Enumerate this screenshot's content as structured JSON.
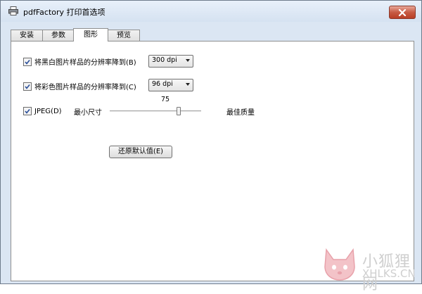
{
  "window": {
    "title": "pdfFactory 打印首选项",
    "icon": "printer-icon",
    "close_icon": "close-icon"
  },
  "tabs": [
    {
      "label": "安装",
      "active": false
    },
    {
      "label": "参数",
      "active": false
    },
    {
      "label": "图形",
      "active": true
    },
    {
      "label": "预览",
      "active": false
    }
  ],
  "graphics": {
    "bw_resolution": {
      "label": "将黑白图片样品的分辨率降到(B)",
      "checked": true,
      "value": "300 dpi"
    },
    "color_resolution": {
      "label": "将彩色图片样品的分辨率降到(C)",
      "checked": true,
      "value": "96 dpi"
    },
    "jpeg": {
      "label": "JPEG(D)",
      "checked": true,
      "min_label": "最小尺寸",
      "max_label": "最佳质量",
      "quality_value": "75",
      "quality_fraction": 0.75
    },
    "restore_button": "还原默认值(E)"
  },
  "watermark": {
    "cn": "小狐狸网",
    "en": "XHLKS.CN"
  },
  "colors": {
    "titlebar": "#d5e2f1",
    "close": "#c75b43",
    "watermark": "#cfcfcf"
  }
}
